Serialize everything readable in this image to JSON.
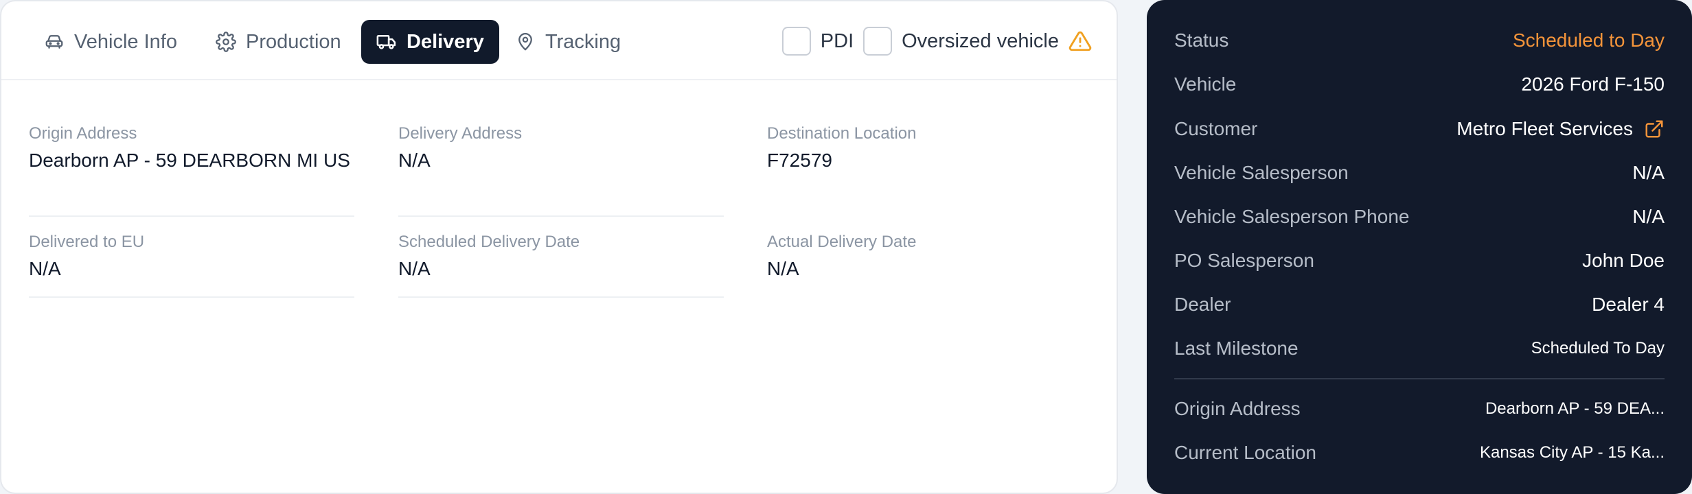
{
  "tabs": [
    {
      "label": "Vehicle Info",
      "icon": "car-icon"
    },
    {
      "label": "Production",
      "icon": "gear-icon"
    },
    {
      "label": "Delivery",
      "icon": "truck-icon"
    },
    {
      "label": "Tracking",
      "icon": "map-pin-icon"
    }
  ],
  "active_tab": "Delivery",
  "checkboxes": {
    "pdi": {
      "label": "PDI",
      "checked": false
    },
    "oversized": {
      "label": "Oversized vehicle",
      "checked": false,
      "icon": "warning-icon"
    }
  },
  "delivery": {
    "origin_address": {
      "label": "Origin Address",
      "value": "Dearborn AP - 59 DEARBORN MI US"
    },
    "delivery_address": {
      "label": "Delivery Address",
      "value": "N/A"
    },
    "destination_location": {
      "label": "Destination Location",
      "value": "F72579"
    },
    "delivered_to_eu": {
      "label": "Delivered to EU",
      "value": "N/A"
    },
    "scheduled_delivery_date": {
      "label": "Scheduled Delivery Date",
      "value": "N/A"
    },
    "actual_delivery_date": {
      "label": "Actual Delivery Date",
      "value": "N/A"
    }
  },
  "summary": {
    "status": {
      "label": "Status",
      "value": "Scheduled to Day"
    },
    "vehicle": {
      "label": "Vehicle",
      "value": "2026 Ford F-150"
    },
    "customer": {
      "label": "Customer",
      "value": "Metro Fleet Services"
    },
    "vehicle_salesperson": {
      "label": "Vehicle Salesperson",
      "value": "N/A"
    },
    "vehicle_salesperson_phone": {
      "label": "Vehicle Salesperson Phone",
      "value": "N/A"
    },
    "po_salesperson": {
      "label": "PO Salesperson",
      "value": "John Doe"
    },
    "dealer": {
      "label": "Dealer",
      "value": "Dealer 4"
    },
    "last_milestone": {
      "label": "Last Milestone",
      "value": "Scheduled To Day"
    },
    "origin_address": {
      "label": "Origin Address",
      "value": "Dearborn AP - 59 DEA..."
    },
    "current_location": {
      "label": "Current Location",
      "value": "Kansas City AP - 15 Ka..."
    }
  },
  "colors": {
    "active_tab_bg": "#111a2b",
    "side_panel_bg": "#121a2b",
    "status_accent": "#f4943a",
    "warning": "#f0a020"
  }
}
